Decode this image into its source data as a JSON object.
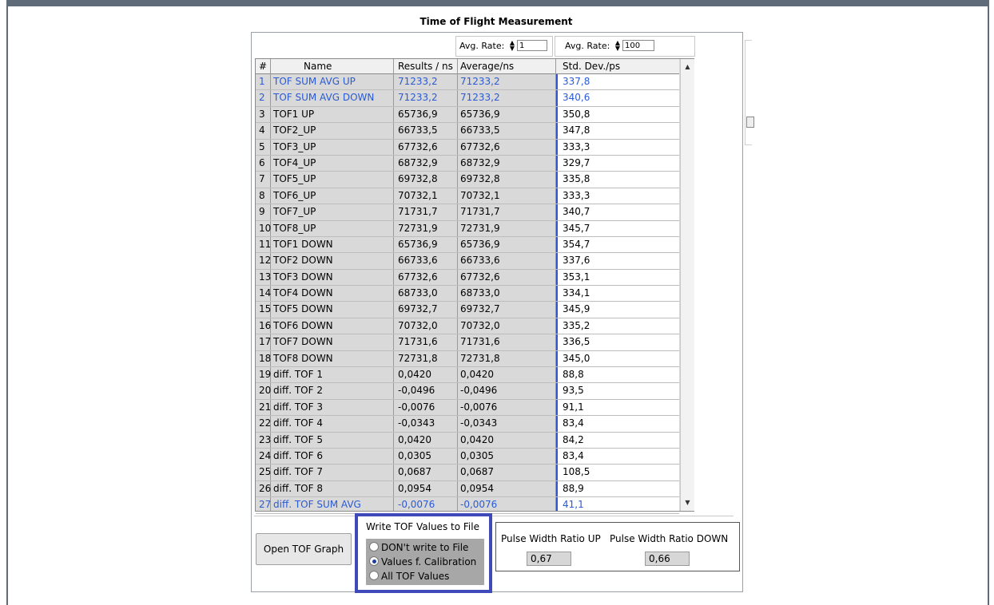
{
  "panel": {
    "title": "Time of Flight Measurement"
  },
  "avg_rate": [
    {
      "label": "Avg. Rate:",
      "value": "1"
    },
    {
      "label": "Avg. Rate:",
      "value": "100"
    }
  ],
  "table": {
    "headers": [
      "#",
      "Name",
      "Results / ns",
      "Average/ns",
      "Std. Dev./ps"
    ],
    "rows": [
      {
        "num": "1",
        "name": "TOF SUM AVG UP",
        "result": "71233,2",
        "average": "71233,2",
        "std": "337,8",
        "highlight": true
      },
      {
        "num": "2",
        "name": "TOF SUM AVG DOWN",
        "result": "71233,2",
        "average": "71233,2",
        "std": "340,6",
        "highlight": true
      },
      {
        "num": "3",
        "name": "TOF1 UP",
        "result": "65736,9",
        "average": "65736,9",
        "std": "350,8",
        "highlight": false
      },
      {
        "num": "4",
        "name": "TOF2_UP",
        "result": "66733,5",
        "average": "66733,5",
        "std": "347,8",
        "highlight": false
      },
      {
        "num": "5",
        "name": "TOF3_UP",
        "result": "67732,6",
        "average": "67732,6",
        "std": "333,3",
        "highlight": false
      },
      {
        "num": "6",
        "name": "TOF4_UP",
        "result": "68732,9",
        "average": "68732,9",
        "std": "329,7",
        "highlight": false
      },
      {
        "num": "7",
        "name": "TOF5_UP",
        "result": "69732,8",
        "average": "69732,8",
        "std": "335,8",
        "highlight": false
      },
      {
        "num": "8",
        "name": "TOF6_UP",
        "result": "70732,1",
        "average": "70732,1",
        "std": "333,3",
        "highlight": false
      },
      {
        "num": "9",
        "name": "TOF7_UP",
        "result": "71731,7",
        "average": "71731,7",
        "std": "340,7",
        "highlight": false
      },
      {
        "num": "10",
        "name": "TOF8_UP",
        "result": "72731,9",
        "average": "72731,9",
        "std": "345,7",
        "highlight": false
      },
      {
        "num": "11",
        "name": "TOF1 DOWN",
        "result": "65736,9",
        "average": "65736,9",
        "std": "354,7",
        "highlight": false
      },
      {
        "num": "12",
        "name": "TOF2 DOWN",
        "result": "66733,6",
        "average": "66733,6",
        "std": "337,6",
        "highlight": false
      },
      {
        "num": "13",
        "name": "TOF3 DOWN",
        "result": "67732,6",
        "average": "67732,6",
        "std": "353,1",
        "highlight": false
      },
      {
        "num": "14",
        "name": "TOF4 DOWN",
        "result": "68733,0",
        "average": "68733,0",
        "std": "334,1",
        "highlight": false
      },
      {
        "num": "15",
        "name": "TOF5 DOWN",
        "result": "69732,7",
        "average": "69732,7",
        "std": "345,9",
        "highlight": false
      },
      {
        "num": "16",
        "name": "TOF6 DOWN",
        "result": "70732,0",
        "average": "70732,0",
        "std": "335,2",
        "highlight": false
      },
      {
        "num": "17",
        "name": "TOF7 DOWN",
        "result": "71731,6",
        "average": "71731,6",
        "std": "336,5",
        "highlight": false
      },
      {
        "num": "18",
        "name": "TOF8 DOWN",
        "result": "72731,8",
        "average": "72731,8",
        "std": "345,0",
        "highlight": false
      },
      {
        "num": "19",
        "name": "diff. TOF 1",
        "result": "0,0420",
        "average": "0,0420",
        "std": "88,8",
        "highlight": false
      },
      {
        "num": "20",
        "name": "diff. TOF 2",
        "result": "-0,0496",
        "average": "-0,0496",
        "std": "93,5",
        "highlight": false
      },
      {
        "num": "21",
        "name": "diff. TOF 3",
        "result": "-0,0076",
        "average": "-0,0076",
        "std": "91,1",
        "highlight": false
      },
      {
        "num": "22",
        "name": "diff. TOF 4",
        "result": "-0,0343",
        "average": "-0,0343",
        "std": "83,4",
        "highlight": false
      },
      {
        "num": "23",
        "name": "diff. TOF 5",
        "result": "0,0420",
        "average": "0,0420",
        "std": "84,2",
        "highlight": false
      },
      {
        "num": "24",
        "name": "diff. TOF 6",
        "result": "0,0305",
        "average": "0,0305",
        "std": "83,4",
        "highlight": false
      },
      {
        "num": "25",
        "name": "diff. TOF 7",
        "result": "0,0687",
        "average": "0,0687",
        "std": "108,5",
        "highlight": false
      },
      {
        "num": "26",
        "name": "diff. TOF 8",
        "result": "0,0954",
        "average": "0,0954",
        "std": "88,9",
        "highlight": false
      },
      {
        "num": "27",
        "name": "diff. TOF SUM AVG",
        "result": "-0,0076",
        "average": "-0,0076",
        "std": "41,1",
        "highlight": true
      }
    ]
  },
  "open_graph_button": "Open TOF Graph",
  "write_file": {
    "title": "Write TOF Values to File",
    "options": [
      "DON't write to File",
      "Values f. Calibration",
      "All TOF Values"
    ],
    "selected_index": 1
  },
  "pulse_width": {
    "up_label": "Pulse Width Ratio UP",
    "up_value": "0,67",
    "down_label": "Pulse Width Ratio DOWN",
    "down_value": "0,66"
  },
  "colors": {
    "highlight_text": "#2a5ad6",
    "selection_border": "#3d4ab8",
    "frame": "#5f6b78"
  },
  "icons": {
    "spinner": "spinner-arrows-icon",
    "scroll_up": "scroll-up-arrow-icon",
    "scroll_down": "scroll-down-arrow-icon"
  }
}
